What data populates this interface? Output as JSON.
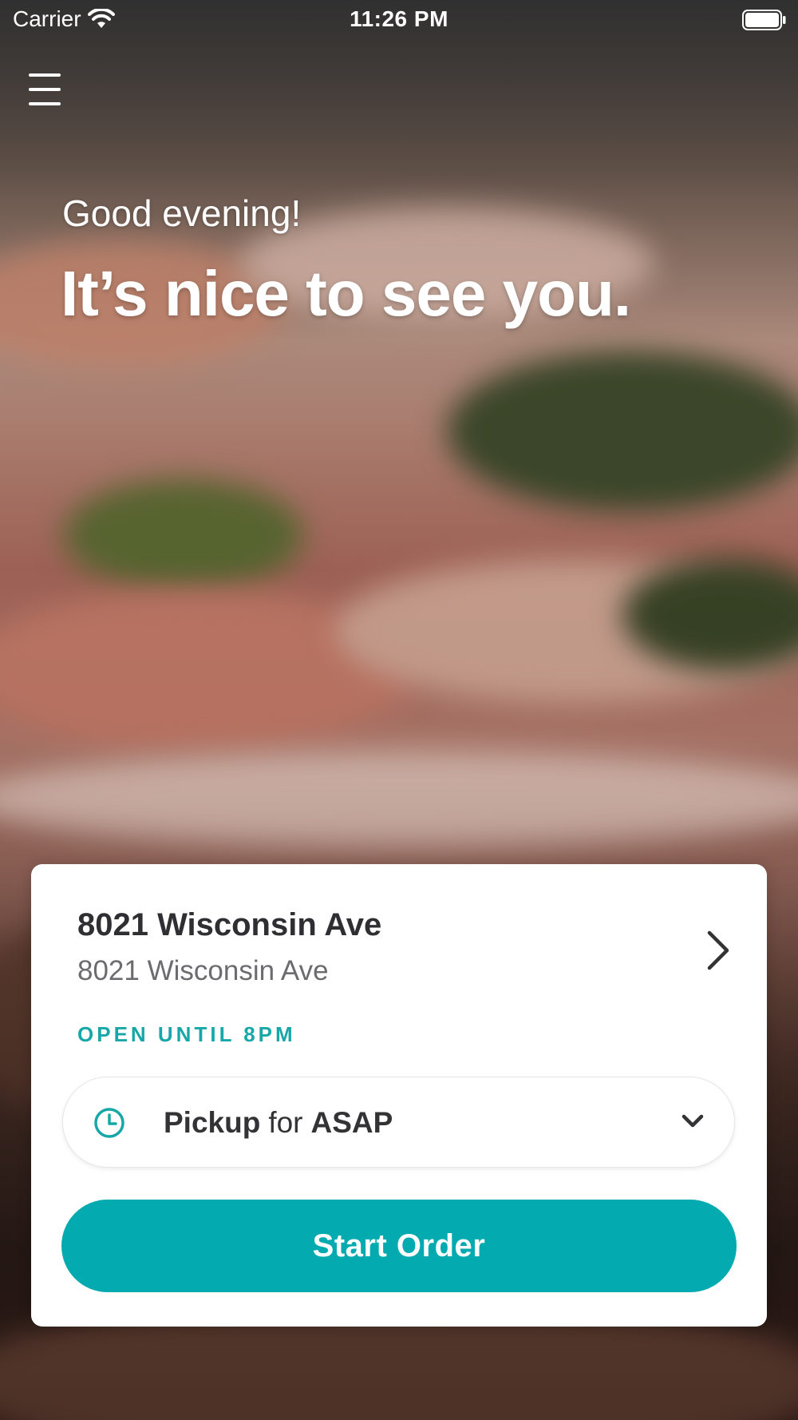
{
  "status_bar": {
    "carrier": "Carrier",
    "time": "11:26 PM"
  },
  "header": {
    "menu_icon": "hamburger-menu-icon"
  },
  "hero": {
    "greeting": "Good evening!",
    "headline": "It’s nice to see you."
  },
  "location_card": {
    "name": "8021 Wisconsin Ave",
    "address": "8021 Wisconsin Ave",
    "hours": "OPEN UNTIL 8PM",
    "order_mode": {
      "icon": "clock-icon",
      "mode": "Pickup",
      "connector": "for",
      "time": "ASAP"
    },
    "start_button": "Start Order"
  },
  "colors": {
    "accent": "#03aaaf",
    "hours_text": "#17a7a9",
    "card_bg": "#ffffff",
    "primary_text": "#2f2f33",
    "secondary_text": "#6c6c70"
  }
}
